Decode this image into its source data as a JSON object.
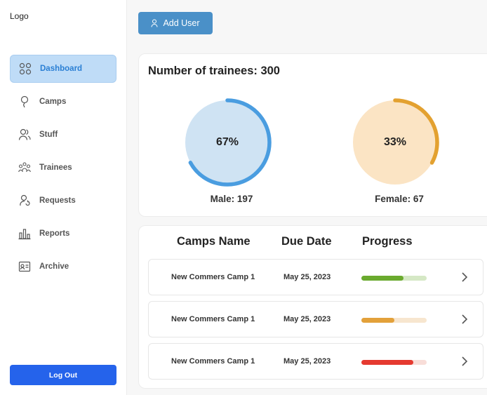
{
  "logo": "Logo",
  "sidebar": {
    "items": [
      {
        "label": "Dashboard",
        "icon": "grid-icon",
        "active": true
      },
      {
        "label": "Camps",
        "icon": "pin-icon",
        "active": false
      },
      {
        "label": "Stuff",
        "icon": "users-icon",
        "active": false
      },
      {
        "label": "Trainees",
        "icon": "group-icon",
        "active": false
      },
      {
        "label": "Requests",
        "icon": "user-refresh-icon",
        "active": false
      },
      {
        "label": "Reports",
        "icon": "bar-chart-icon",
        "active": false
      },
      {
        "label": "Archive",
        "icon": "id-card-icon",
        "active": false
      }
    ],
    "logout_label": "Log Out"
  },
  "add_user_label": "Add User",
  "trainees": {
    "title": "Number of trainees: 300",
    "male": {
      "percent_label": "67%",
      "fraction": 0.67,
      "label": "Male: 197",
      "color": "#4a9de0",
      "bg": "#cfe3f3"
    },
    "female": {
      "percent_label": "33%",
      "fraction": 0.33,
      "label": "Female: 67",
      "color": "#e3a130",
      "bg": "#fbe4c4"
    }
  },
  "camps_table": {
    "headers": {
      "name": "Camps Name",
      "due": "Due Date",
      "progress": "Progress"
    },
    "rows": [
      {
        "name": "New Commers Camp 1",
        "due": "May 25, 2023",
        "progress": 0.65,
        "color": "#6aaa2e",
        "track": "#d5e8c5"
      },
      {
        "name": "New Commers Camp 1",
        "due": "May 25, 2023",
        "progress": 0.5,
        "color": "#e3a13a",
        "track": "#f7e6cf"
      },
      {
        "name": "New Commers Camp 1",
        "due": "May 25, 2023",
        "progress": 0.8,
        "color": "#e53a30",
        "track": "#f8ddd8"
      }
    ]
  }
}
